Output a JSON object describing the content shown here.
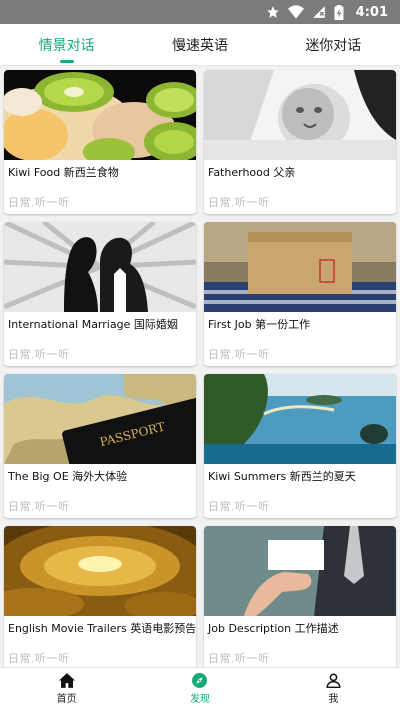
{
  "status": {
    "time": "4:01"
  },
  "tabs": [
    {
      "label": "情景对话"
    },
    {
      "label": "慢速英语"
    },
    {
      "label": "迷你对话"
    }
  ],
  "cards": [
    {
      "title": "Kiwi Food 新西兰食物",
      "subtitle": "日常.听一听"
    },
    {
      "title": "Fatherhood 父亲",
      "subtitle": "日常.听一听"
    },
    {
      "title": "International Marriage 国际婚姻",
      "subtitle": "日常.听一听"
    },
    {
      "title": "First Job 第一份工作",
      "subtitle": "日常.听一听"
    },
    {
      "title": "The Big OE 海外大体验",
      "subtitle": "日常.听一听"
    },
    {
      "title": "Kiwi Summers 新西兰的夏天",
      "subtitle": "日常.听一听"
    },
    {
      "title": "English Movie Trailers 英语电影预告片",
      "subtitle": "日常.听一听"
    },
    {
      "title": "Job Description 工作描述",
      "subtitle": "日常.听一听"
    }
  ],
  "thumb_text": {
    "passport": "PASSPORT"
  },
  "nav": [
    {
      "label": "首页",
      "icon": "home-icon"
    },
    {
      "label": "发现",
      "icon": "compass-icon"
    },
    {
      "label": "我",
      "icon": "person-icon"
    }
  ],
  "colors": {
    "accent": "#1aa97a",
    "statusbar": "#7b7b7b"
  }
}
